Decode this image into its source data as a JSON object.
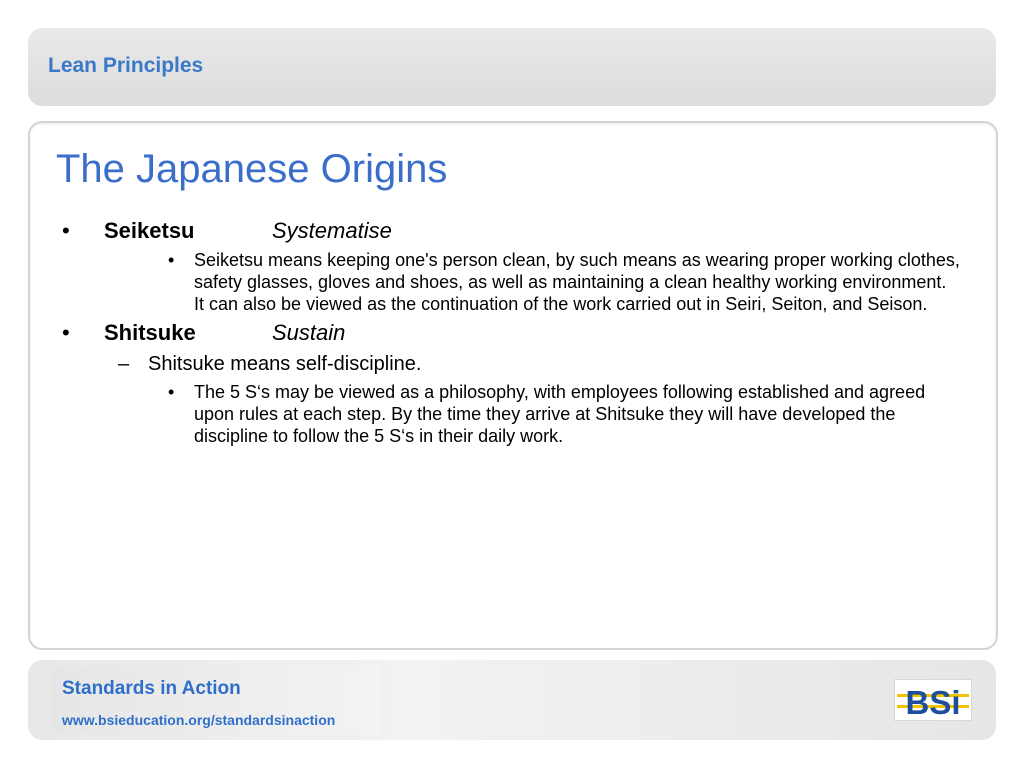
{
  "header": {
    "title": "Lean Principles"
  },
  "slide": {
    "title": "The Japanese Origins",
    "items": [
      {
        "term": "Seiketsu",
        "translation": "Systematise",
        "details": [
          "Seiketsu means keeping one's person clean, by such means as wearing proper working clothes, safety glasses, gloves and shoes, as well as maintaining a clean healthy working environment. It can also be viewed as the continuation of the work carried out in Seiri, Seiton, and Seison."
        ]
      },
      {
        "term": "Shitsuke",
        "translation": "Sustain",
        "subpoint": "Shitsuke means self-discipline.",
        "details": [
          "The 5 S‘s may be viewed as a philosophy, with employees following established and agreed upon rules at each step. By the time they arrive at Shitsuke they will have developed the discipline to follow the 5 S‘s in their daily work."
        ]
      }
    ]
  },
  "footer": {
    "title": "Standards in Action",
    "url": "www.bsieducation.org/standardsinaction",
    "logo_text": "BSi"
  },
  "colors": {
    "title_blue": "#3a6ec8",
    "footer_blue": "#2f6fc9",
    "logo_blue": "#1f4f9c",
    "logo_yellow": "#f2c400"
  }
}
